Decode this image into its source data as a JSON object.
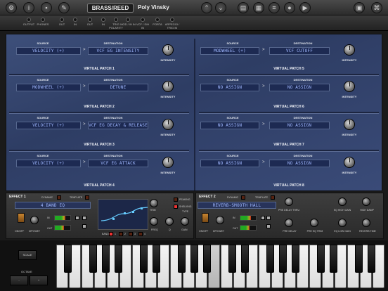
{
  "topbar": {
    "category": "BRASS/REED",
    "program": "Poly Vinsky"
  },
  "jacks": [
    "OUTPUT",
    "PHONES",
    "OUT",
    "IN",
    "OUT",
    "IN",
    "TRIG POLARITY",
    "MOD / W IN",
    "VCF / S/H IN",
    "PORTA",
    "ARPEGGI / TRIG IN"
  ],
  "power_label": "POWER",
  "patches": [
    {
      "title": "VIRTUAL PATCH 1",
      "source": "VELOCITY (+)",
      "destination": "VCF EG INTENSITY"
    },
    {
      "title": "VIRTUAL PATCH 2",
      "source": "MODWHEEL (+)",
      "destination": "DETUNE"
    },
    {
      "title": "VIRTUAL PATCH 3",
      "source": "VELOCITY (+)",
      "destination": "VCF EG DECAY & RELEASE"
    },
    {
      "title": "VIRTUAL PATCH 4",
      "source": "VELOCITY (+)",
      "destination": "VCF EG ATTACK"
    },
    {
      "title": "VIRTUAL PATCH 5",
      "source": "MODWHEEL (+)",
      "destination": "VCF CUTOFF"
    },
    {
      "title": "VIRTUAL PATCH 6",
      "source": "NO ASSIGN",
      "destination": "NO ASSIGN"
    },
    {
      "title": "VIRTUAL PATCH 7",
      "source": "NO ASSIGN",
      "destination": "NO ASSIGN"
    },
    {
      "title": "VIRTUAL PATCH 8",
      "source": "NO ASSIGN",
      "destination": "NO ASSIGN"
    }
  ],
  "labels": {
    "source": "SOURCE",
    "destination": "DESTINATION",
    "intensity": "INTENSITY",
    "gt": ">",
    "lo": "-10",
    "hi": "+10",
    "zero": "0"
  },
  "effect1": {
    "name": "EFFECT 1",
    "dynamic": "DYNAMIC",
    "template": "TEMPLATE",
    "preset": "4 BAND EQ",
    "onoff": "ON/OFF",
    "drywet": "DRY/WET",
    "in": "IN",
    "out": "OUT",
    "trim": "TRIM",
    "peaking": "PEAKING",
    "shelving": "SHELVING",
    "type": "TYPE",
    "freq": "FREQ",
    "q": "Q",
    "gain": "GAIN",
    "band": "BAND",
    "bands": [
      "1",
      "2",
      "3",
      "4"
    ]
  },
  "effect2": {
    "name": "EFFECT 2",
    "dynamic": "DYNAMIC",
    "template": "TEMPLATE",
    "preset": "REVERB-SMOOTH HALL",
    "onoff": "ON/OFF",
    "drywet": "DRY/WET",
    "in": "IN",
    "out": "OUT",
    "knobs": [
      "PRE DELAY THRU",
      "EQ HIGH GAIN",
      "HIGH DAMP",
      "PRE DELAY",
      "PRE EQ TRIM",
      "EQ LOW GAIN",
      "REVERB TIME"
    ]
  },
  "keyboard": {
    "scale": "SCALE",
    "octave": "OCTAVE",
    "minus": "-",
    "plus": "+"
  }
}
